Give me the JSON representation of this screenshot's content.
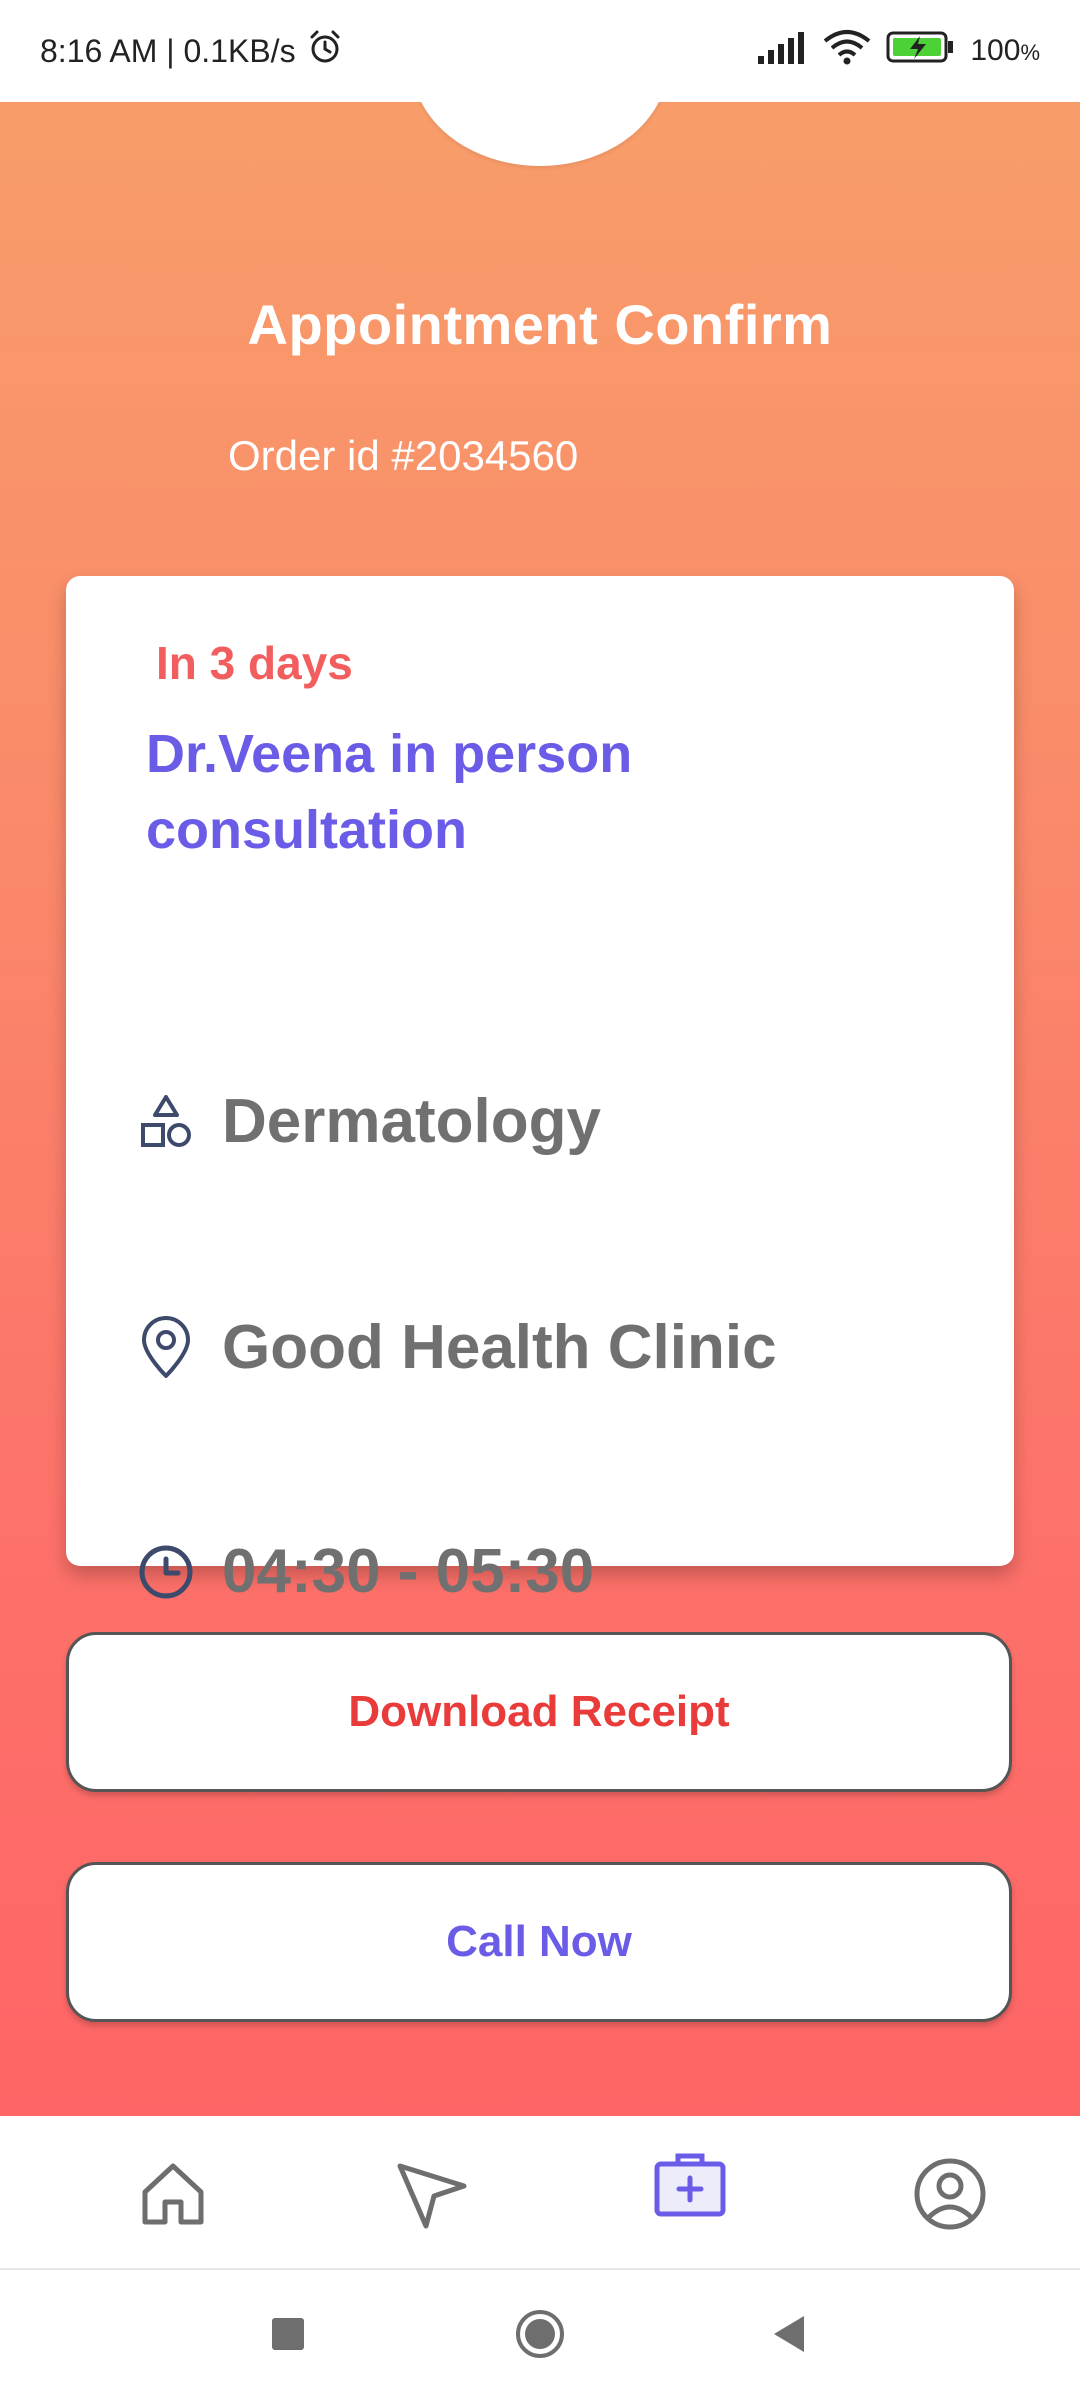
{
  "status_bar": {
    "time": "8:16 AM | 0.1KB/s",
    "battery": "100",
    "battery_unit": "%",
    "icons": [
      "alarm-icon",
      "signal-icon",
      "wifi-icon",
      "battery-charging-icon"
    ]
  },
  "header": {
    "title": "Appointment Confirm",
    "order_id": "Order id #2034560"
  },
  "card": {
    "when": "In 3 days",
    "consultation": "Dr.Veena in person consultation",
    "department": "Dermatology",
    "clinic": "Good Health Clinic",
    "time": "04:30 - 05:30",
    "icons": [
      "shapes-icon",
      "location-pin-icon",
      "clock-icon"
    ]
  },
  "actions": {
    "download_label": "Download Receipt",
    "call_label": "Call Now"
  },
  "bottom_nav": {
    "items": [
      "home-icon",
      "send-icon",
      "medical-kit-icon",
      "profile-icon"
    ],
    "active": "medical-kit-icon",
    "active_color": "#6b5ce7"
  },
  "colors": {
    "gradient_top": "#f89d6a",
    "gradient_bottom": "#fe6566",
    "accent_purple": "#6b5ce7",
    "accent_red": "#ea3b3b"
  }
}
